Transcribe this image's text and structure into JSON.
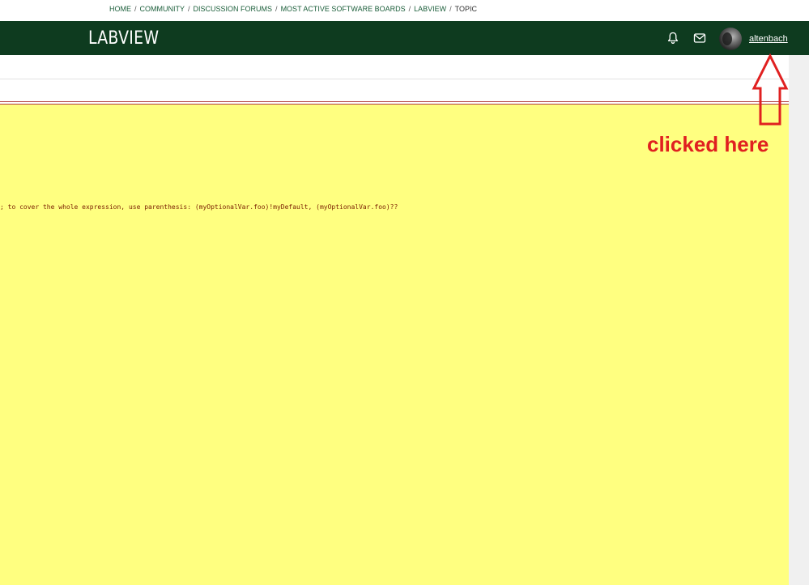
{
  "breadcrumb": {
    "items": [
      {
        "label": "HOME"
      },
      {
        "label": "COMMUNITY"
      },
      {
        "label": "DISCUSSION FORUMS"
      },
      {
        "label": "MOST ACTIVE SOFTWARE BOARDS"
      },
      {
        "label": "LABVIEW"
      }
    ],
    "current": "TOPIC",
    "separator": "/"
  },
  "header": {
    "brand": "LABVIEW",
    "username": "altenbach",
    "icons": [
      "bell-icon",
      "mail-icon"
    ],
    "background_color": "#0e3b1f"
  },
  "content": {
    "code_text": "; to cover the whole expression, use parenthesis: (myOptionalVar.foo)!myDefault, (myOptionalVar.foo)??",
    "highlight_color": "#ffff80"
  },
  "annotation": {
    "text": "clicked here",
    "color": "#e02020"
  }
}
